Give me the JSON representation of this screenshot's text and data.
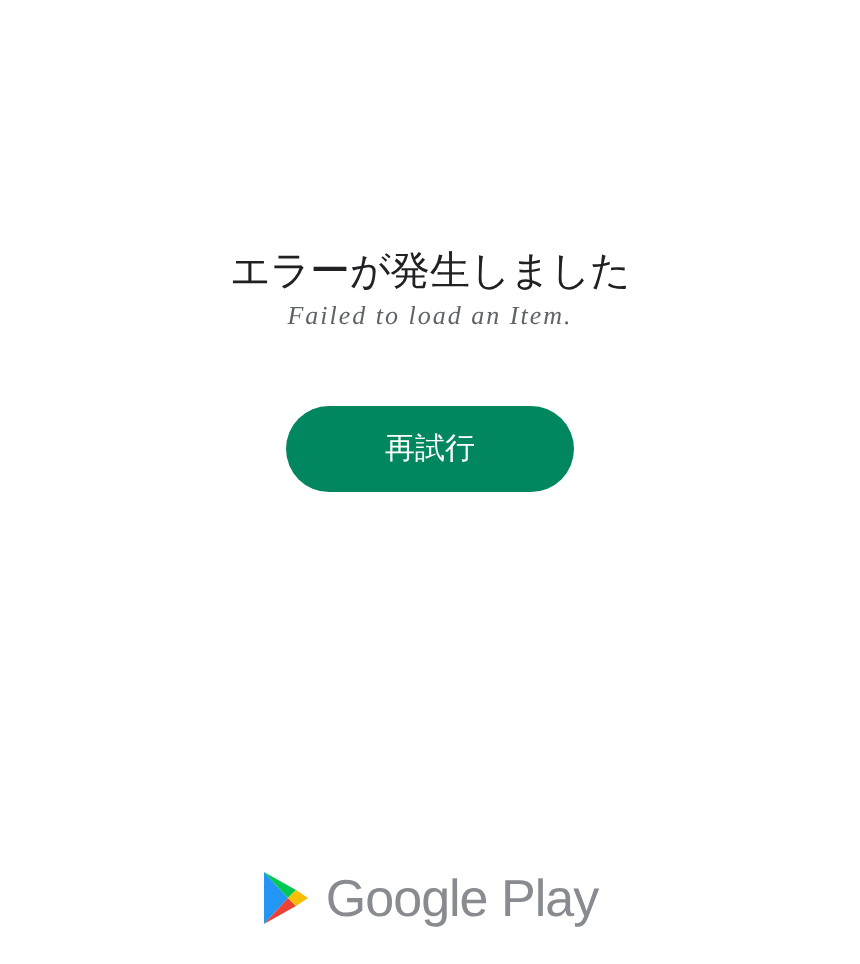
{
  "error": {
    "title": "エラーが発生しました",
    "message": "Failed to load an Item."
  },
  "retry_button": {
    "label": "再試行"
  },
  "footer": {
    "brand": "Google Play"
  }
}
